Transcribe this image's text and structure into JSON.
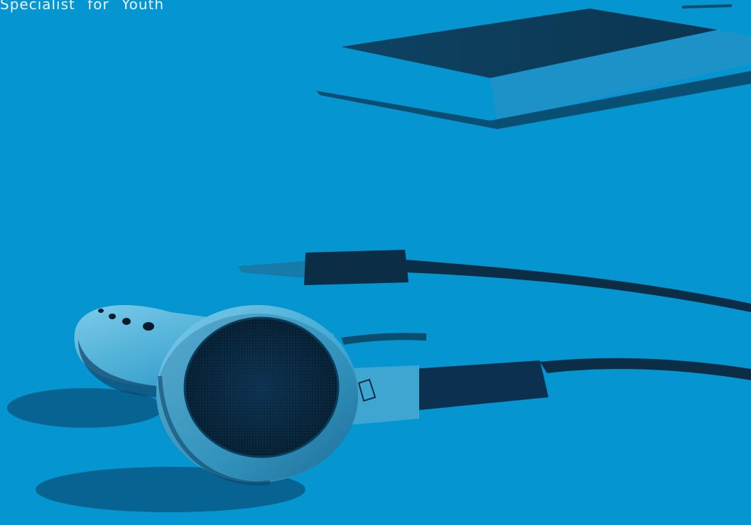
{
  "caption": {
    "text": "Specialist for Youth"
  },
  "colors": {
    "background": "#0596d2",
    "shadow": "#0a3d5c",
    "dark_object": "#0b2d45",
    "light_highlight": "#bfe6f6",
    "caption_text": "#eaf6fc"
  },
  "icons": {
    "player": "music-player-icon",
    "earphone": "earphone-icon"
  }
}
